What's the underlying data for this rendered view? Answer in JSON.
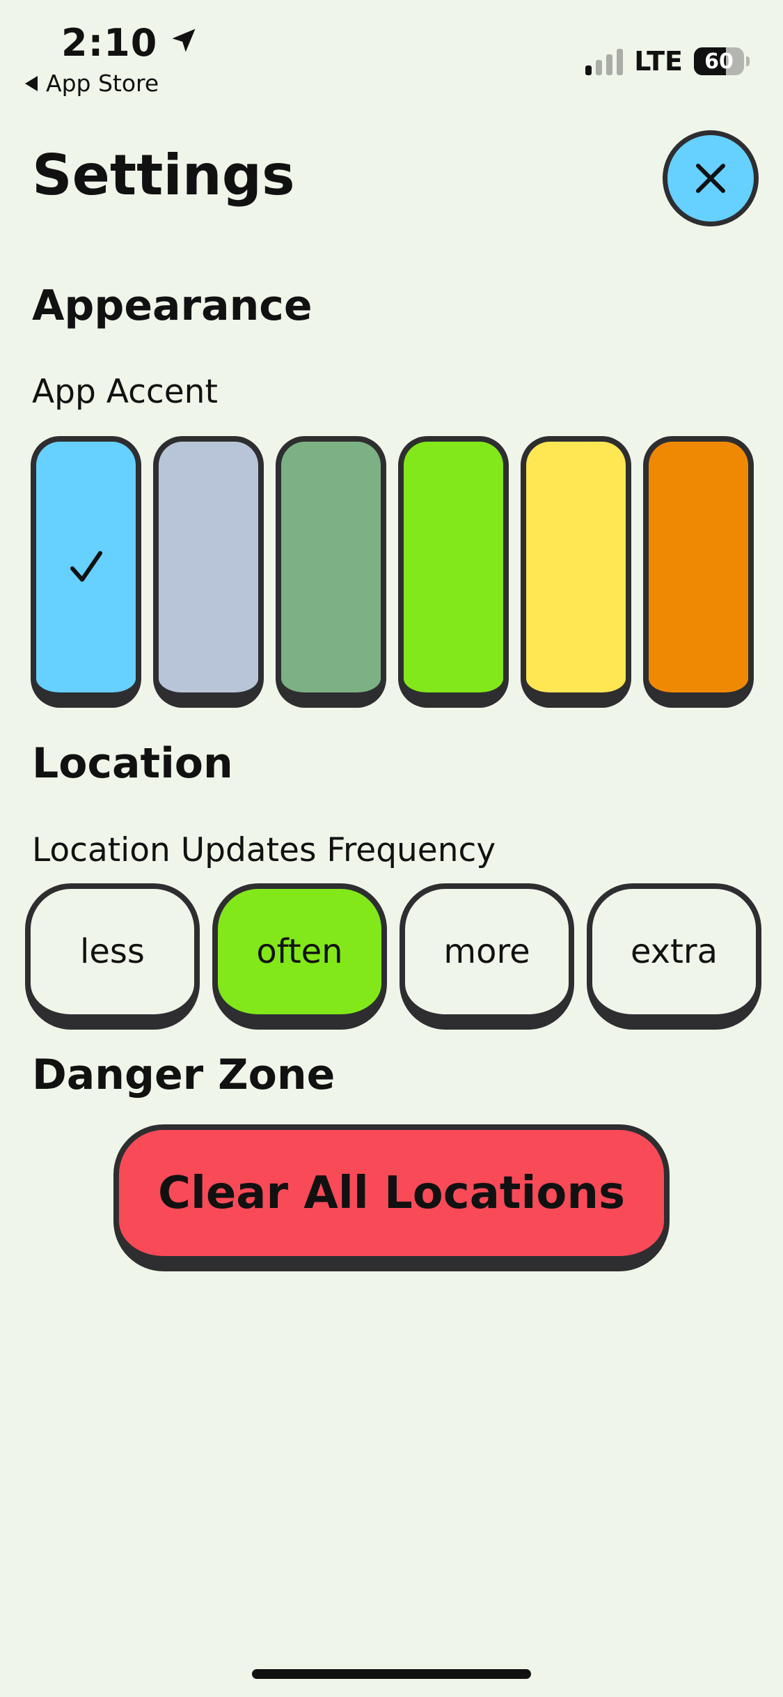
{
  "status_bar": {
    "time": "2:10",
    "back_label": "App Store",
    "network": "LTE",
    "battery": "60",
    "battery_level": 0.6,
    "signal_bars_active": 1,
    "signal_bars_total": 4
  },
  "header": {
    "title": "Settings",
    "close_icon": "close-icon"
  },
  "appearance": {
    "heading": "Appearance",
    "accent_label": "App Accent",
    "swatches": [
      {
        "color": "#66d0ff",
        "selected": true
      },
      {
        "color": "#b8c5d8",
        "selected": false
      },
      {
        "color": "#7cb183",
        "selected": false
      },
      {
        "color": "#82e81a",
        "selected": false
      },
      {
        "color": "#ffe653",
        "selected": false
      },
      {
        "color": "#ef8903",
        "selected": false
      }
    ]
  },
  "location": {
    "heading": "Location",
    "frequency_label": "Location Updates Frequency",
    "options": [
      "less",
      "often",
      "more",
      "extra"
    ],
    "selected": "often",
    "selected_color": "#82e81a"
  },
  "danger": {
    "heading": "Danger Zone",
    "clear_label": "Clear All Locations",
    "button_color": "#f94a58"
  }
}
